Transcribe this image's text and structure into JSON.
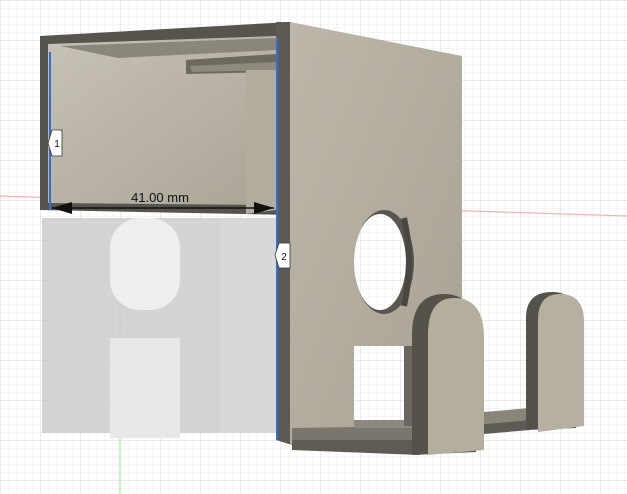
{
  "viewport": {
    "dimension_label": "41.00 mm",
    "edge_tag_1": "1",
    "edge_tag_2": "2"
  },
  "colors": {
    "background": "#ffffff",
    "grid_minor": "#e6e6e6",
    "grid_major": "#cfcfcf",
    "axis_red": "#f2a0a0",
    "axis_green": "#9fe39f",
    "face_light": "#b9b3a6",
    "face_mid": "#a49e90",
    "face_dark": "#6e6a62",
    "edge_selected": "#2f6fd6",
    "shadow": "#c9c9c9"
  }
}
